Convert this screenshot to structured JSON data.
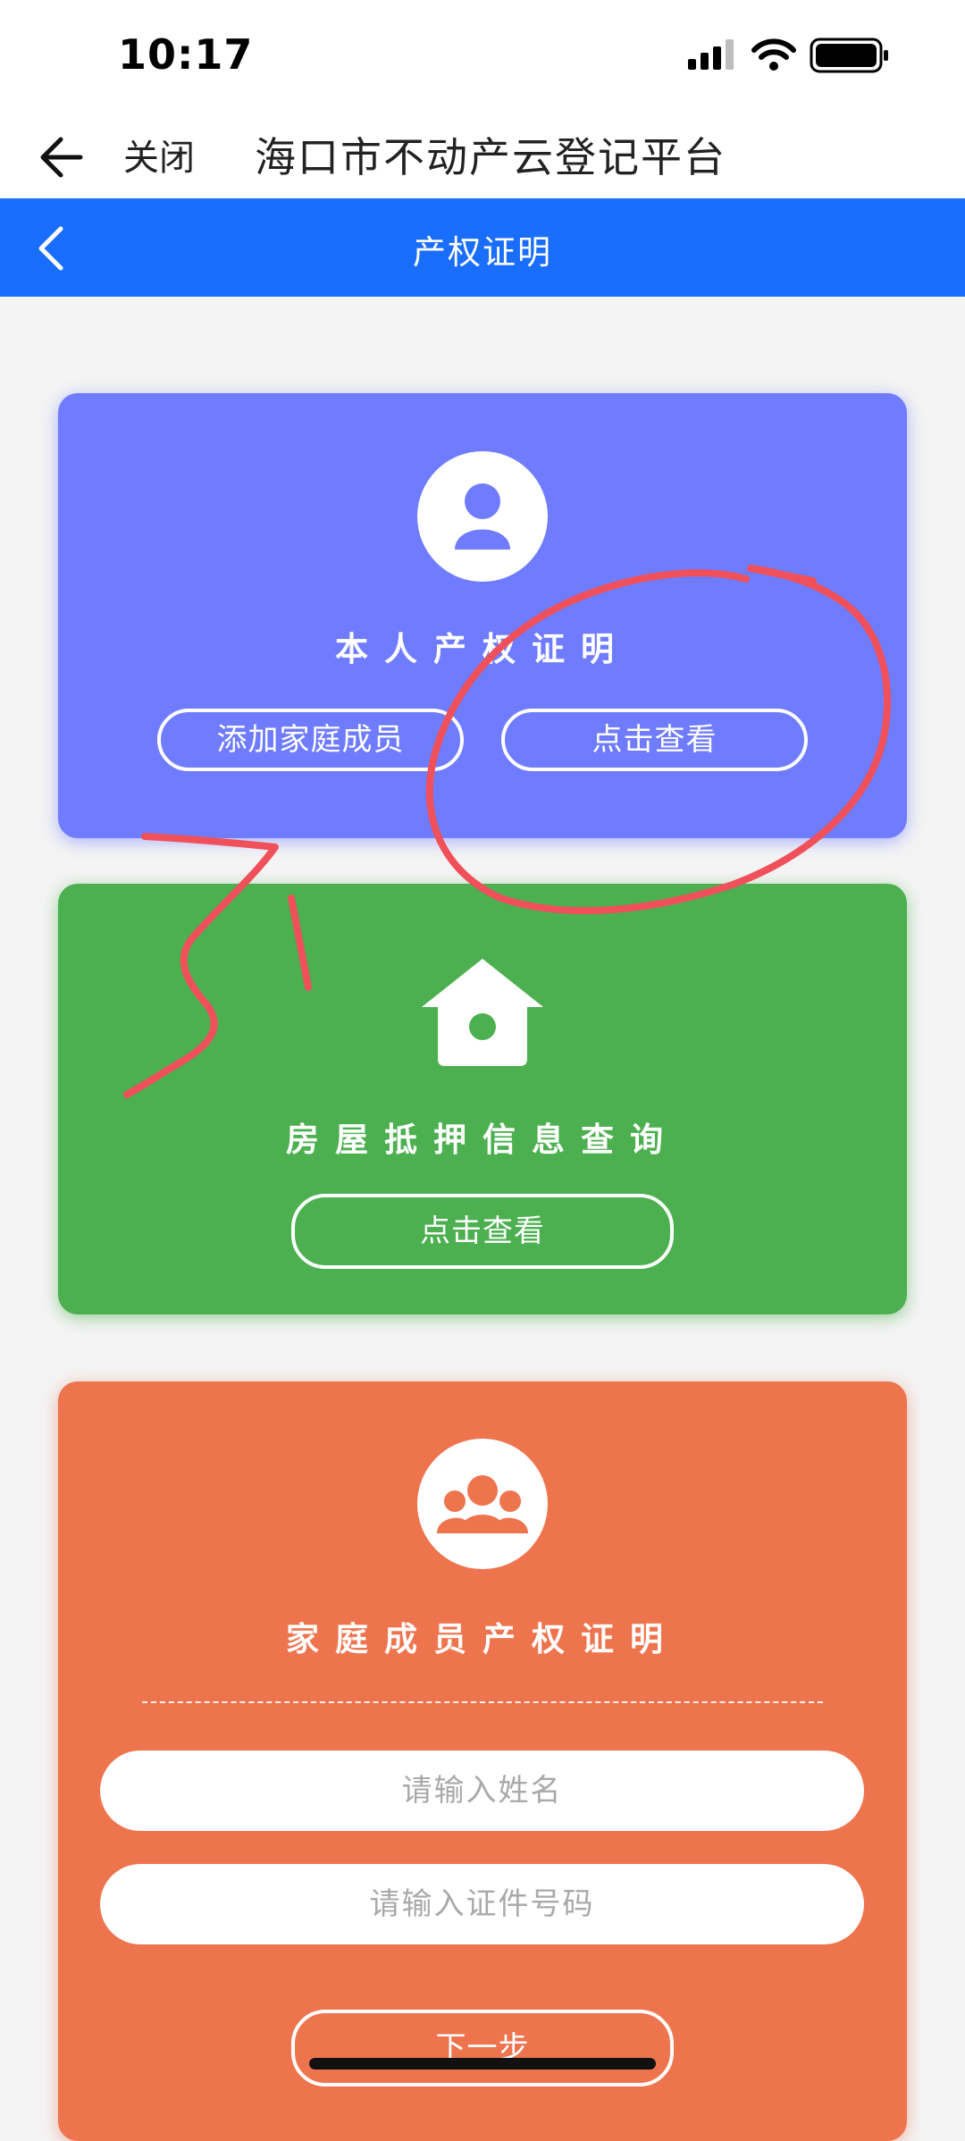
{
  "status_bar": {
    "time": "10:17"
  },
  "title_bar": {
    "close_label": "关闭",
    "title": "海口市不动产云登记平台"
  },
  "nav_bar": {
    "title": "产权证明"
  },
  "cards": {
    "self": {
      "title": "本人产权证明",
      "add_member_button": "添加家庭成员",
      "view_button": "点击查看",
      "color": "#6f7cff"
    },
    "mortgage": {
      "title": "房屋抵押信息查询",
      "view_button": "点击查看",
      "color": "#4cb050"
    },
    "family": {
      "title": "家庭成员产权证明",
      "name_placeholder": "请输入姓名",
      "id_placeholder": "请输入证件号码",
      "next_button": "下一步",
      "color": "#ee744e"
    }
  },
  "icons": [
    "back-arrow-icon",
    "chevron-left-icon",
    "person-icon",
    "house-icon",
    "group-icon",
    "signal-icon",
    "wifi-icon",
    "battery-icon"
  ],
  "colors": {
    "nav": "#1a6efe",
    "annotation": "#f0505a"
  }
}
